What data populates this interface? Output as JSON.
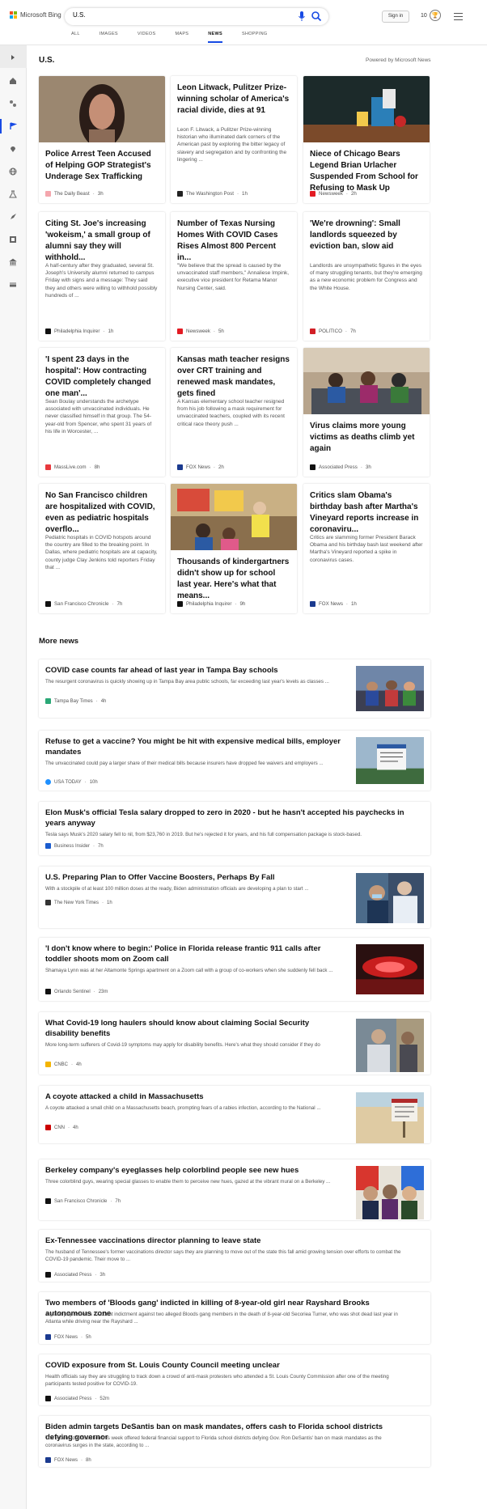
{
  "header": {
    "brand": "Microsoft Bing",
    "query": "U.S.",
    "sign_in": "Sign in",
    "rewards_count": "10",
    "tabs": [
      "ALL",
      "IMAGES",
      "VIDEOS",
      "MAPS",
      "NEWS",
      "SHOPPING"
    ],
    "active_tab": "NEWS",
    "accent_color": "#174ae4"
  },
  "sidebar": {
    "icons": [
      "expand-icon",
      "home-icon",
      "sports-icon",
      "flag-icon",
      "location-icon",
      "globe-icon",
      "science-icon",
      "rocket-icon",
      "film-icon",
      "building-icon",
      "money-icon"
    ],
    "active": "flag-icon"
  },
  "section": {
    "title": "U.S.",
    "powered_by": "Powered by Microsoft News"
  },
  "cards": [
    {
      "title": "Police Arrest Teen Accused of Helping GOP Strategist's Underage Sex Trafficking",
      "summary": "",
      "source": "The Daily Beast",
      "time": "3h",
      "has_image": true,
      "fav_color": "#f4a6ad"
    },
    {
      "title": "Leon Litwack, Pulitzer Prize-winning scholar of America's racial divide, dies at 91",
      "summary": "Leon F. Litwack, a Pulitzer Prize-winning historian who illuminated dark corners of the American past by exploring the bitter legacy of slavery and segregation and by confronting the lingering ...",
      "source": "The Washington Post",
      "time": "1h",
      "has_image": false,
      "fav_color": "#222222"
    },
    {
      "title": "Niece of Chicago Bears Legend Brian Urlacher Suspended From School for Refusing to Mask Up",
      "summary": "",
      "source": "Newsweek",
      "time": "2h",
      "has_image": true,
      "fav_color": "#e31b23"
    },
    {
      "title": "Citing St. Joe's increasing 'wokeism,' a small group of alumni say they will withhold...",
      "summary": "A half-century after they graduated, several St. Joseph's University alumni returned to campus Friday with signs and a message: They said they and others were willing to withhold possibly hundreds of ...",
      "source": "Philadelphia Inquirer",
      "time": "1h",
      "has_image": false,
      "fav_color": "#111111"
    },
    {
      "title": "Number of Texas Nursing Homes With COVID Cases Rises Almost 800 Percent in...",
      "summary": "\"We believe that the spread is caused by the unvaccinated staff members,\" Annaliese Impink, executive vice president for Retama Manor Nursing Center, said.",
      "source": "Newsweek",
      "time": "5h",
      "has_image": false,
      "fav_color": "#e31b23"
    },
    {
      "title": "'We're drowning': Small landlords squeezed by eviction ban, slow aid",
      "summary": "Landlords are unsympathetic figures in the eyes of many struggling tenants, but they're emerging as a new economic problem for Congress and the White House.",
      "source": "POLITICO",
      "time": "7h",
      "has_image": false,
      "fav_color": "#d21f26"
    },
    {
      "title": "'I spent 23 days in the hospital': How contracting COVID completely changed one man'...",
      "summary": "Sean Boulay understands the archetype associated with unvaccinated individuals. He never classified himself in that group. The 54-year-old from Spencer, who spent 31 years of his life in Worcester, ...",
      "source": "MassLive.com",
      "time": "8h",
      "has_image": false,
      "fav_color": "#e8383d"
    },
    {
      "title": "Kansas math teacher resigns over CRT training and renewed mask mandates, gets fined",
      "summary": "A Kansas elementary school teacher resigned from his job following a mask requirement for unvaccinated teachers, coupled with its recent critical race theory push ...",
      "source": "FOX News",
      "time": "2h",
      "has_image": false,
      "fav_color": "#1b3a8f"
    },
    {
      "title": "Virus claims more young victims as deaths climb yet again",
      "summary": "",
      "source": "Associated Press",
      "time": "3h",
      "has_image": true,
      "fav_color": "#111111"
    },
    {
      "title": "No San Francisco children are hospitalized with COVID, even as pediatric hospitals overflo...",
      "summary": "Pediatric hospitals in COVID hotspots around the country are filled to the breaking point. In Dallas, where pediatric hospitals are at capacity, county judge Clay Jenkins told reporters Friday that ...",
      "source": "San Francisco Chronicle",
      "time": "7h",
      "has_image": false,
      "fav_color": "#111111"
    },
    {
      "title": "Thousands of kindergartners didn't show up for school last year. Here's what that means...",
      "summary": "",
      "source": "Philadelphia Inquirer",
      "time": "9h",
      "has_image": true,
      "fav_color": "#111111"
    },
    {
      "title": "Critics slam Obama's birthday bash after Martha's Vineyard reports increase in coronaviru...",
      "summary": "Critics are slamming former President Barack Obama and his birthday bash last weekend after Martha's Vineyard reported a spike in coronavirus cases.",
      "source": "FOX News",
      "time": "1h",
      "has_image": false,
      "fav_color": "#1b3a8f"
    }
  ],
  "more_news_title": "More news",
  "more_news": [
    {
      "title": "COVID case counts far ahead of last year in Tampa Bay schools",
      "summary": "The resurgent coronavirus is quickly showing up in Tampa Bay area public schools, far exceeding last year's levels as classes ...",
      "source": "Tampa Bay Times",
      "time": "4h",
      "has_image": true,
      "fav_color": "#2aa876"
    },
    {
      "title": "Refuse to get a vaccine? You might be hit with expensive medical bills, employer mandates",
      "summary": "The unvaccinated could pay a larger share of their medical bills because insurers have dropped fee waivers and employers ...",
      "source": "USA TODAY",
      "time": "10h",
      "has_image": true,
      "fav_color": "#1e90ff"
    },
    {
      "title": "Elon Musk's official Tesla salary dropped to zero in 2020 - but he hasn't accepted his paychecks in years anyway",
      "summary": "Tesla says Musk's 2020 salary fell to nil, from $23,760 in 2019. But he's rejected it for years, and his full compensation package is stock-based.",
      "source": "Business Insider",
      "time": "7h",
      "has_image": false,
      "fav_color": "#1a5ccf"
    },
    {
      "title": "U.S. Preparing Plan to Offer Vaccine Boosters, Perhaps By Fall",
      "summary": "With a stockpile of at least 100 million doses at the ready, Biden administration officials are developing a plan to start ...",
      "source": "The New York Times",
      "time": "1h",
      "has_image": true,
      "fav_color": "#333333"
    },
    {
      "title": "'I don't know where to begin:' Police in Florida release frantic 911 calls after toddler shoots mom on Zoom call",
      "summary": "Shamaya Lynn was at her Altamonte Springs apartment on a Zoom call with a group of co-workers when she suddenly fell back ...",
      "source": "Orlando Sentinel",
      "time": "23m",
      "has_image": true,
      "fav_color": "#111111"
    },
    {
      "title": "What Covid-19 long haulers should know about claiming Social Security disability benefits",
      "summary": "More long-term sufferers of Covid-19 symptoms may apply for disability benefits. Here's what they should consider if they do",
      "source": "CNBC",
      "time": "4h",
      "has_image": true,
      "fav_color": "#f4b400"
    },
    {
      "title": "A coyote attacked a child in Massachusetts",
      "summary": "A coyote attacked a small child on a Massachusetts beach, prompting fears of a rabies infection, according to the National ...",
      "source": "CNN",
      "time": "4h",
      "has_image": true,
      "fav_color": "#cc0000"
    },
    {
      "title": "Berkeley company's eyeglasses help colorblind people see new hues",
      "summary": "Three colorblind guys, wearing special glasses to enable them to perceive new hues, gazed at the vibrant mural on a Berkeley ...",
      "source": "San Francisco Chronicle",
      "time": "7h",
      "has_image": true,
      "fav_color": "#111111"
    },
    {
      "title": "Ex-Tennessee vaccinations director planning to leave state",
      "summary": "The husband of Tennessee's former vaccinations director says they are planning to move out of the state this fall amid growing tension over efforts to combat the COVID-19 pandemic. Their move to ...",
      "source": "Associated Press",
      "time": "3h",
      "has_image": false,
      "fav_color": "#111111"
    },
    {
      "title": "Two members of 'Bloods gang' indicted in killing of 8-year-old girl near Rayshard Brooks autonomous zone",
      "summary": "A grand jury issued a 37-count indictment against two alleged Bloods gang members in the death of 8-year-old Secoriea Turner, who was shot dead last year in Atlanta while driving near the Rayshard ...",
      "source": "FOX News",
      "time": "5h",
      "has_image": false,
      "fav_color": "#1b3a8f"
    },
    {
      "title": "COVID exposure from St. Louis County Council meeting unclear",
      "summary": "Health officials say they are struggling to track down a crowd of anti-mask protesters who attended a St. Louis County Commission after one of the meeting participants tested positive for COVID-19.",
      "source": "Associated Press",
      "time": "52m",
      "has_image": false,
      "fav_color": "#111111"
    },
    {
      "title": "Biden admin targets DeSantis ban on mask mandates, offers cash to Florida school districts defying governor",
      "summary": "The Biden administration this week offered federal financial support to Florida school districts defying Gov. Ron DeSantis' ban on mask mandates as the coronavirus surges in the state, according to ...",
      "source": "FOX News",
      "time": "8h",
      "has_image": false,
      "fav_color": "#1b3a8f"
    }
  ]
}
